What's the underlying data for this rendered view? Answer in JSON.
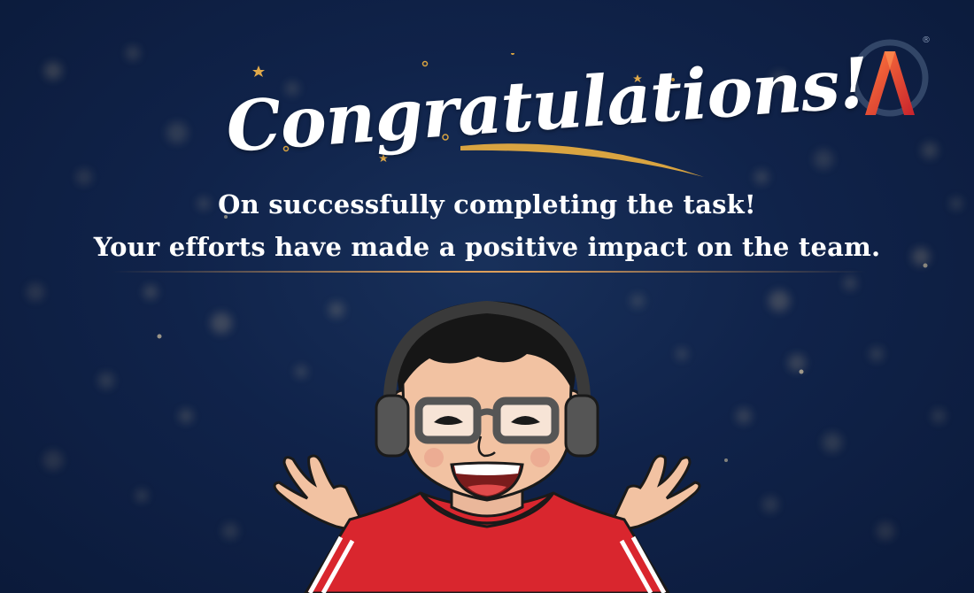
{
  "card": {
    "title": "Congratulations!",
    "line1": "On successfully completing the task!",
    "line2": "Your efforts have made a positive impact on the team."
  },
  "logo": {
    "icon": "letter-a-logo-icon",
    "mark": "A",
    "registered": "®"
  },
  "avatar": {
    "icon": "cartoon-avatar-icon"
  },
  "colors": {
    "background": "#10234a",
    "text": "#ffffff",
    "gold": "#d9a441",
    "logo_gradient_start": "#ff6a3d",
    "logo_gradient_end": "#c8232c",
    "hoodie": "#d9262e"
  }
}
